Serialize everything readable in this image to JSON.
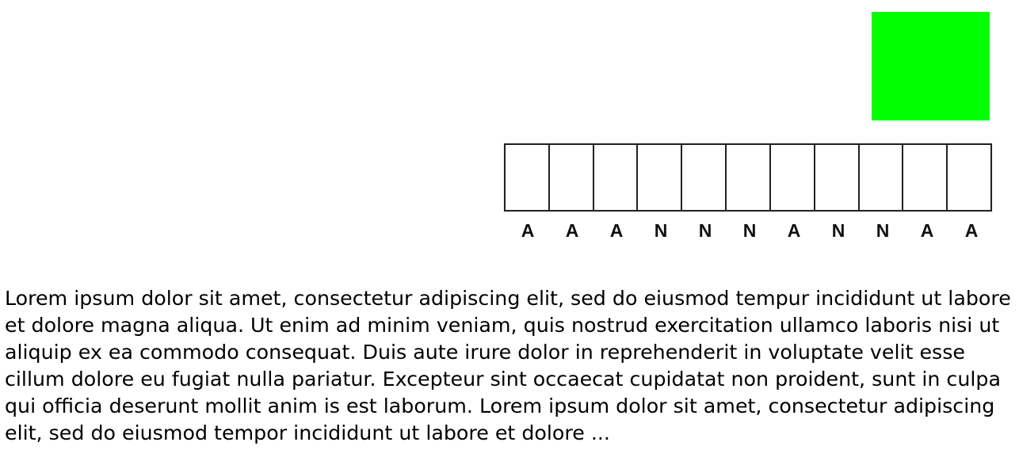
{
  "colors": {
    "green_square": "#00ff00",
    "cell_border": "#222222"
  },
  "strip": {
    "cell_count": 11,
    "labels": [
      "A",
      "A",
      "A",
      "N",
      "N",
      "N",
      "A",
      "N",
      "N",
      "A",
      "A"
    ]
  },
  "paragraph": {
    "text": "Lorem ipsum dolor sit amet, consectetur adipiscing elit, sed do eiusmod tempur incididunt ut labore et dolore magna aliqua. Ut enim ad minim veniam, quis nostrud exercitation ullamco laboris nisi ut aliquip ex ea commodo consequat. Duis aute irure dolor in reprehenderit in voluptate velit esse cillum dolore eu fugiat nulla pariatur. Excepteur sint occaecat cupidatat non proident, sunt in culpa qui officia deserunt mollit anim is est laborum. Lorem ipsum dolor sit amet, consectetur adipiscing elit, sed do eiusmod tempor incididunt ut labore et dolore ..."
  }
}
